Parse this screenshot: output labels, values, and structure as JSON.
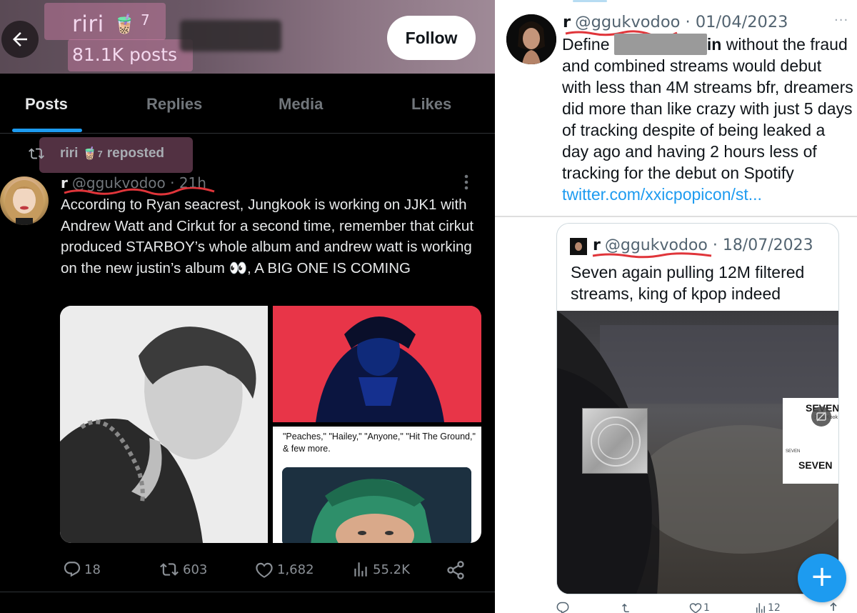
{
  "left_profile": {
    "name": "riri",
    "name_emoji": "🧋",
    "name_sup": "7",
    "post_count": "81.1K posts",
    "follow_label": "Follow"
  },
  "tabs": [
    "Posts",
    "Replies",
    "Media",
    "Likes"
  ],
  "active_tab": "Posts",
  "repost": {
    "name": "riri",
    "emoji": "🧋",
    "sup": "7",
    "label": "reposted"
  },
  "left_post": {
    "author_name": "r",
    "handle_time": "@ggukvodoo · 21h",
    "text": "According to Ryan seacrest, Jungkook is working on JJK1 with Andrew Watt and Cirkut for a second time, remember that cirkut produced STARBOY’s whole album and andrew watt is working on the new justin’s album 👀, A BIG ONE IS COMING",
    "article_snippet": "\"Peaches,\" \"Hailey,\" \"Anyone,\" \"Hit The Ground,\" & few more.",
    "actions": {
      "replies": "18",
      "reposts": "603",
      "likes": "1,682",
      "views": "55.2K"
    }
  },
  "right_tweet": {
    "author_name": "r",
    "handle_date": "@ggukvodoo · 01/04/2023",
    "text_before": "Define ",
    "text_bold": "in",
    "text_after": " without the fraud and combined streams would debut with less than 4M streams bfr, dreamers did more than like crazy with just 5 days of tracking despite of being leaked a day ago and having 2 hours less of tracking for the debut on Spotify ",
    "link": "twitter.com/xxicpopicon/st...",
    "more": "···"
  },
  "quote_tweet": {
    "author_name": "r",
    "handle_date": "@ggukvodoo · 18/07/2023",
    "text": "Seven again pulling 12M filtered streams, king of kpop indeed",
    "album_title": "SEVEN",
    "album_artist": "Jung Kook",
    "album_small": "SEVEN",
    "album_title_2": "SEVEN"
  },
  "right_actions": {
    "likes": "1",
    "views": "12"
  },
  "colors": {
    "accent": "#1d9bf0",
    "dark_bg": "#000000",
    "highlight_pink": "#f08cbe",
    "underline_red": "#e0353a"
  },
  "icons": [
    "back-arrow-icon",
    "repost-icon",
    "reply-icon",
    "like-icon",
    "views-icon",
    "share-icon",
    "more-icon",
    "sensitive-media-icon",
    "compose-plus-icon"
  ]
}
